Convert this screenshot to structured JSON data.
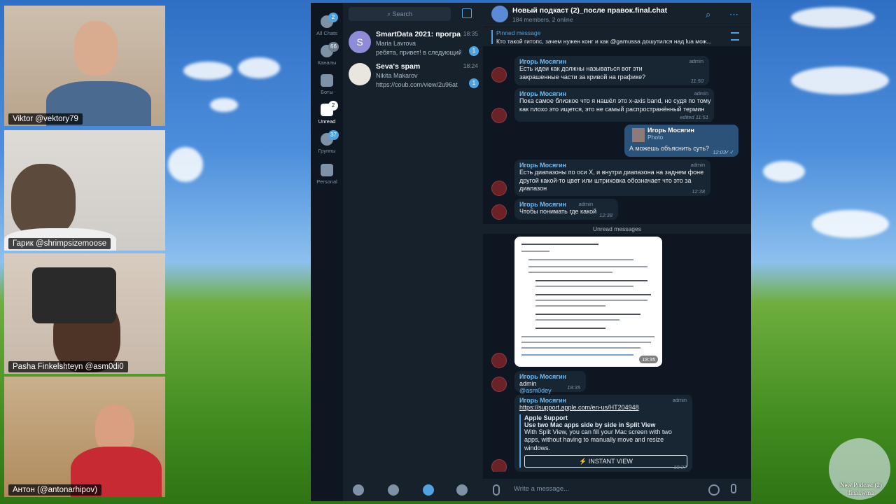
{
  "participants": [
    {
      "name": "Viktor @vektory79"
    },
    {
      "name": "Гарик @shrimpsizemoose"
    },
    {
      "name": "Pasha Finkelshteyn @asm0di0"
    },
    {
      "name": "Антон (@antonarhipov)"
    }
  ],
  "rail": [
    {
      "label": "All Chats",
      "badge": "2",
      "icon": "chats-icon"
    },
    {
      "label": "Каналы",
      "badge": "66",
      "icon": "channels-icon"
    },
    {
      "label": "Боты",
      "badge": "",
      "icon": "bots-icon"
    },
    {
      "label": "Unread",
      "badge": "2",
      "icon": "unread-icon"
    },
    {
      "label": "Группы",
      "badge": "37",
      "icon": "groups-icon"
    },
    {
      "label": "Personal",
      "badge": "",
      "icon": "folder-icon"
    }
  ],
  "search": {
    "placeholder": "Search"
  },
  "chats": [
    {
      "title": "SmartData 2021: програ...",
      "time": "18:35",
      "sender": "Maria Lavrova",
      "preview": "ребята, привет! в следующий...",
      "badge": "1",
      "avatar_letter": "S",
      "avatar_color": "#8e8cd8"
    },
    {
      "title": "Seva's spam",
      "time": "18:24",
      "sender": "Nikita Makarov",
      "preview": "https://coub.com/view/2u96at",
      "badge": "1",
      "avatar_letter": "",
      "avatar_color": "#e9e6df"
    }
  ],
  "header": {
    "title": "Новый подкаст (2)_после правок.final.chat",
    "subtitle": "184 members, 2 online"
  },
  "pinned": {
    "label": "Pinned message",
    "text": "Кто такой гитопс, зачем нужен конг и как @gamussa дошутился над lua мож..."
  },
  "messages": [
    {
      "sender": "Игорь Мосягин",
      "role": "admin",
      "text": "Есть идеи как должны называться вот эти закрашенные части за кривой на графике?",
      "time": "11:50"
    },
    {
      "sender": "Игорь Мосягин",
      "role": "admin",
      "text": "Пока самое близкое что я нашёл это x-axis band, но судя по тому как плохо это ищется, это не самый распространённый термин",
      "time": "edited 11:51"
    },
    {
      "reply_sender": "Игорь Мосягин",
      "reply_type": "Photo",
      "text": "А можешь объяснить суть?",
      "time": "12:03"
    },
    {
      "sender": "Игорь Мосягин",
      "role": "admin",
      "text": "Есть диапазоны по оси X, и внутри диапазона на заднем фоне другой какой-то цвет или штриховка обозначает что это за диапазон",
      "time": "12:38"
    },
    {
      "sender": "Игорь Мосягин",
      "role": "admin",
      "text": "Чтобы понимать где какой",
      "time": "12:38"
    }
  ],
  "unread_divider": "Unread messages",
  "screenshot_time": "18:35",
  "mention_msg": {
    "sender": "Игорь Мосягин",
    "role": "admin",
    "text": "@asm0dey",
    "time": "18:35"
  },
  "link_msg": {
    "sender": "Игорь Мосягин",
    "role": "admin",
    "url": "https://support.apple.com/en-us/HT204948",
    "site": "Apple Support",
    "title": "Use two Mac apps side by side in Split View",
    "description": "With Split View, you can fill your Mac screen with two apps, without having to manually move and resize windows.",
    "button": "⚡ INSTANT VIEW",
    "time": "18:37"
  },
  "composer": {
    "placeholder": "Write a message..."
  },
  "media_file": {
    "line1": "New Podcast (2)",
    "line2": "final.wma"
  },
  "colors": {
    "accent": "#4fa3e0",
    "sidebar": "#0e1621",
    "panel": "#17212b",
    "bubble_in": "#182533",
    "bubble_out": "#2b5278"
  }
}
